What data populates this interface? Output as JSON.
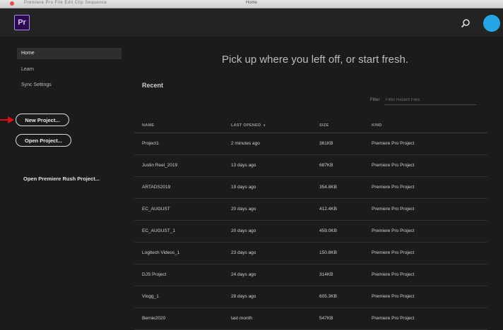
{
  "window": {
    "title": "Home",
    "menu_text": "Premiere Pro  File  Edit  Clip  Sequence"
  },
  "app": {
    "logo_text": "Pr",
    "accent": "#9999ff",
    "avatar_color": "#25a7e6"
  },
  "sidebar": {
    "items": [
      {
        "label": "Home",
        "active": true
      },
      {
        "label": "Learn",
        "active": false
      },
      {
        "label": "Sync Settings",
        "active": false
      }
    ],
    "new_project": "New Project...",
    "open_project": "Open Project...",
    "rush_project": "Open Premiere Rush Project..."
  },
  "main": {
    "headline": "Pick up where you left off, or start fresh.",
    "recent_label": "Recent",
    "filter": {
      "label": "Filter",
      "placeholder": "Filter Recent Files"
    }
  },
  "table": {
    "headers": {
      "name": "NAME",
      "last_opened": "LAST OPENED",
      "sort_indicator": "∨",
      "size": "SIZE",
      "kind": "KIND"
    },
    "rows": [
      {
        "name": "Project1",
        "last_opened": "2 minutes ago",
        "size": "361KB",
        "kind": "Premiere Pro Project"
      },
      {
        "name": "Justin Reel_2019",
        "last_opened": "13 days ago",
        "size": "687KB",
        "kind": "Premiere Pro Project"
      },
      {
        "name": "ARTADS2019",
        "last_opened": "19 days ago",
        "size": "354.8KB",
        "kind": "Premiere Pro Project"
      },
      {
        "name": "EC_AUGUST",
        "last_opened": "20 days ago",
        "size": "412.4KB",
        "kind": "Premiere Pro Project"
      },
      {
        "name": "EC_AUGUST_1",
        "last_opened": "20 days ago",
        "size": "459.0KB",
        "kind": "Premiere Pro Project"
      },
      {
        "name": "Logitech Videos_1",
        "last_opened": "23 days ago",
        "size": "150.8KB",
        "kind": "Premiere Pro Project"
      },
      {
        "name": "DJS Project",
        "last_opened": "24 days ago",
        "size": "314KB",
        "kind": "Premiere Pro Project"
      },
      {
        "name": "Vlogg_1",
        "last_opened": "28 days ago",
        "size": "605.3KB",
        "kind": "Premiere Pro Project"
      },
      {
        "name": "Bernie2020",
        "last_opened": "last month",
        "size": "547KB",
        "kind": "Premiere Pro Project"
      }
    ]
  },
  "annotation": {
    "arrow_color": "#e0100c"
  }
}
